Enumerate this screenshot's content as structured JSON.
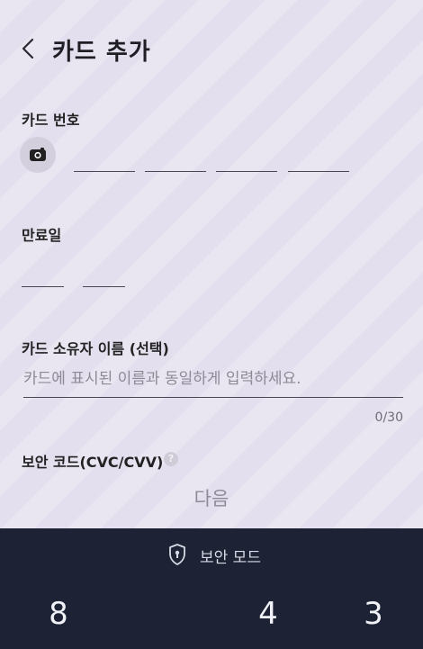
{
  "header": {
    "title": "카드 추가",
    "back_icon": "chevron-left-icon"
  },
  "card_number": {
    "label": "카드 번호",
    "camera_icon": "camera-icon",
    "segments": 4
  },
  "expiry": {
    "label": "만료일"
  },
  "owner": {
    "label": "카드 소유자 이름 (선택)",
    "placeholder": "카드에 표시된 이름과 동일하게 입력하세요.",
    "counter": "0/30"
  },
  "security_code": {
    "label": "보안 코드(CVC/CVV)",
    "help_icon": "question-icon",
    "help_text": "?"
  },
  "next_button": {
    "label": "다음"
  },
  "keypad": {
    "secure_mode_label": "보안 모드",
    "shield_icon": "shield-lock-icon",
    "visible_keys": [
      "8",
      "4",
      "3"
    ]
  },
  "colors": {
    "background": "#e3dfee",
    "keypad_bg": "#1d2234",
    "text": "#1f1e25"
  }
}
